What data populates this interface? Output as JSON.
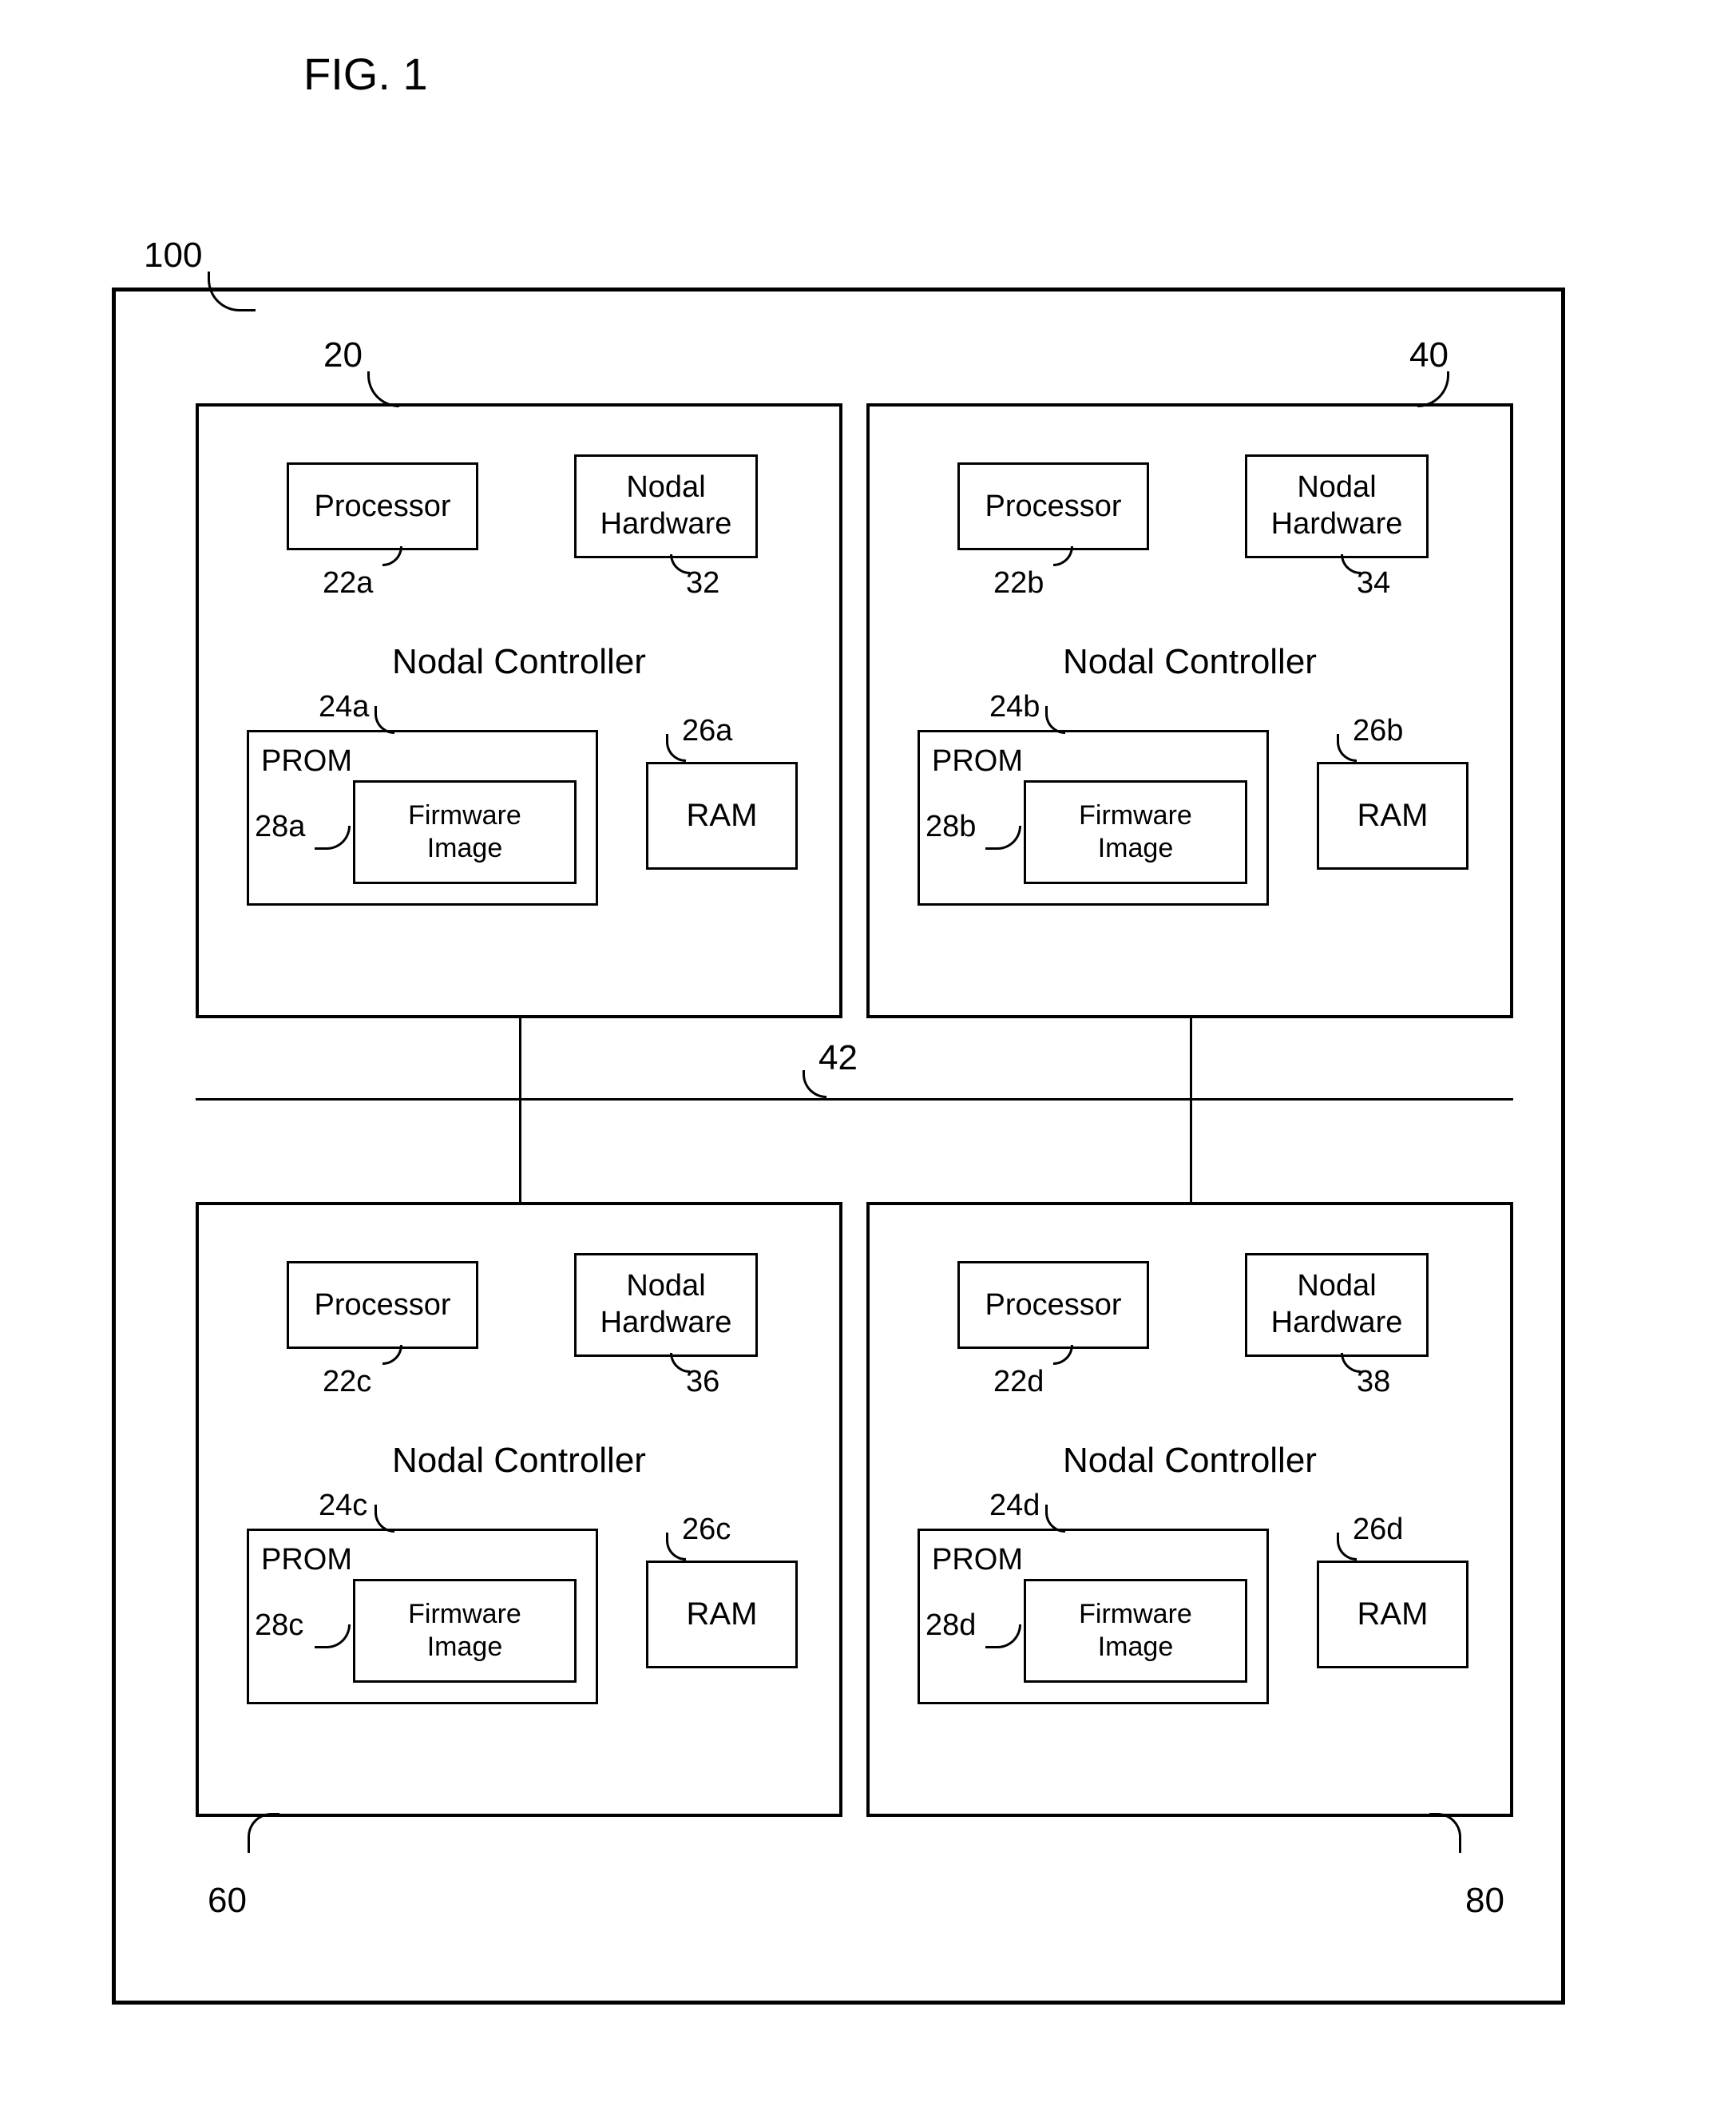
{
  "figure_title": "FIG. 1",
  "outer_ref": "100",
  "bus_ref": "42",
  "nodes": [
    {
      "ref": "20",
      "processor": {
        "label": "Processor",
        "ref": "22a"
      },
      "hardware": {
        "label": "Nodal\nHardware",
        "ref": "32"
      },
      "controller_label": "Nodal Controller",
      "prom": {
        "label": "PROM",
        "ref": "24a"
      },
      "firmware": {
        "label": "Firmware\nImage",
        "ref": "28a"
      },
      "ram": {
        "label": "RAM",
        "ref": "26a"
      }
    },
    {
      "ref": "40",
      "processor": {
        "label": "Processor",
        "ref": "22b"
      },
      "hardware": {
        "label": "Nodal\nHardware",
        "ref": "34"
      },
      "controller_label": "Nodal Controller",
      "prom": {
        "label": "PROM",
        "ref": "24b"
      },
      "firmware": {
        "label": "Firmware\nImage",
        "ref": "28b"
      },
      "ram": {
        "label": "RAM",
        "ref": "26b"
      }
    },
    {
      "ref": "60",
      "processor": {
        "label": "Processor",
        "ref": "22c"
      },
      "hardware": {
        "label": "Nodal\nHardware",
        "ref": "36"
      },
      "controller_label": "Nodal Controller",
      "prom": {
        "label": "PROM",
        "ref": "24c"
      },
      "firmware": {
        "label": "Firmware\nImage",
        "ref": "28c"
      },
      "ram": {
        "label": "RAM",
        "ref": "26c"
      }
    },
    {
      "ref": "80",
      "processor": {
        "label": "Processor",
        "ref": "22d"
      },
      "hardware": {
        "label": "Nodal\nHardware",
        "ref": "38"
      },
      "controller_label": "Nodal Controller",
      "prom": {
        "label": "PROM",
        "ref": "24d"
      },
      "firmware": {
        "label": "Firmware\nImage",
        "ref": "28d"
      },
      "ram": {
        "label": "RAM",
        "ref": "26d"
      }
    }
  ]
}
